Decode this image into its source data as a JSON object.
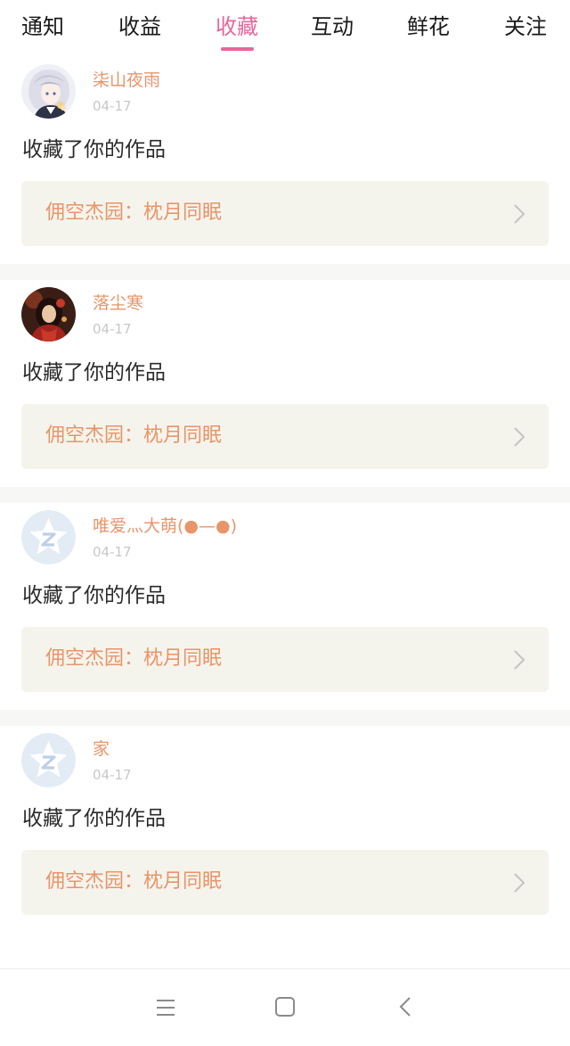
{
  "tabs": [
    {
      "label": "通知"
    },
    {
      "label": "收益"
    },
    {
      "label": "收藏",
      "active": true
    },
    {
      "label": "互动"
    },
    {
      "label": "鲜花"
    },
    {
      "label": "关注"
    }
  ],
  "feed": [
    {
      "username": "柒山夜雨",
      "date": "04-17",
      "action": "收藏了你的作品",
      "work_title": "佣空杰园：枕月同眠",
      "avatar": "anime-character-avatar"
    },
    {
      "username": "落尘寒",
      "date": "04-17",
      "action": "收藏了你的作品",
      "work_title": "佣空杰园：枕月同眠",
      "avatar": "portrait-avatar"
    },
    {
      "username": "唯爱灬大萌(●—●)",
      "date": "04-17",
      "action": "收藏了你的作品",
      "work_title": "佣空杰园：枕月同眠",
      "avatar": "default-star-avatar"
    },
    {
      "username": "家",
      "date": "04-17",
      "action": "收藏了你的作品",
      "work_title": "佣空杰园：枕月同眠",
      "avatar": "default-star-avatar"
    }
  ],
  "navbar": {
    "icons": [
      "menu-icon",
      "home-square-icon",
      "back-chevron-icon"
    ]
  },
  "colors": {
    "accent": "#e8669a",
    "username": "#e8956a",
    "work_box_bg": "#f5f4ec"
  }
}
